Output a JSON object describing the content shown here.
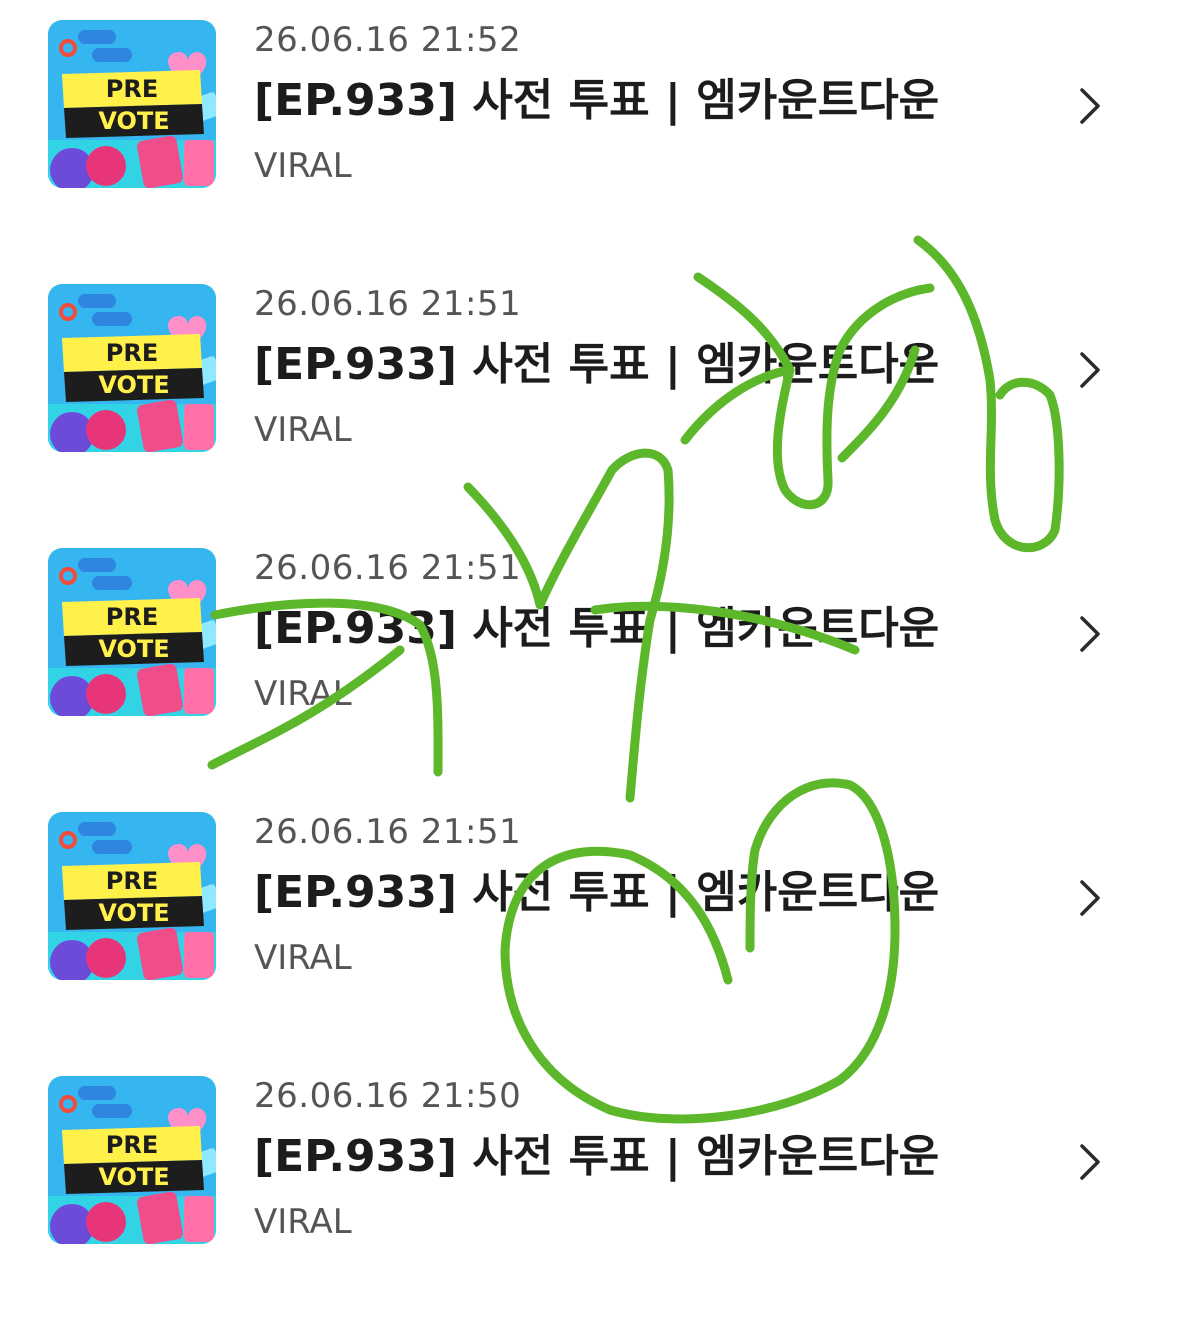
{
  "items": [
    {
      "date": "26.06.16 21:52",
      "title": "[EP.933] 사전 투표 | 엠카운트다운",
      "category": "VIRAL"
    },
    {
      "date": "26.06.16 21:51",
      "title": "[EP.933] 사전 투표 | 엠카운트다운",
      "category": "VIRAL"
    },
    {
      "date": "26.06.16 21:51",
      "title": "[EP.933] 사전 투표 | 엠카운트다운",
      "category": "VIRAL"
    },
    {
      "date": "26.06.16 21:51",
      "title": "[EP.933] 사전 투표 | 엠카운트다운",
      "category": "VIRAL"
    },
    {
      "date": "26.06.16 21:50",
      "title": "[EP.933] 사전 투표 | 엠카운트다운",
      "category": "VIRAL"
    }
  ],
  "thumbnail": {
    "line1": "PRE",
    "line2": "VOTE"
  },
  "overlay": {
    "stroke_color": "#5cb82a"
  },
  "icons": {
    "thumbnail": "pre-vote-thumbnail-icon",
    "chevron": "chevron-right-icon"
  }
}
